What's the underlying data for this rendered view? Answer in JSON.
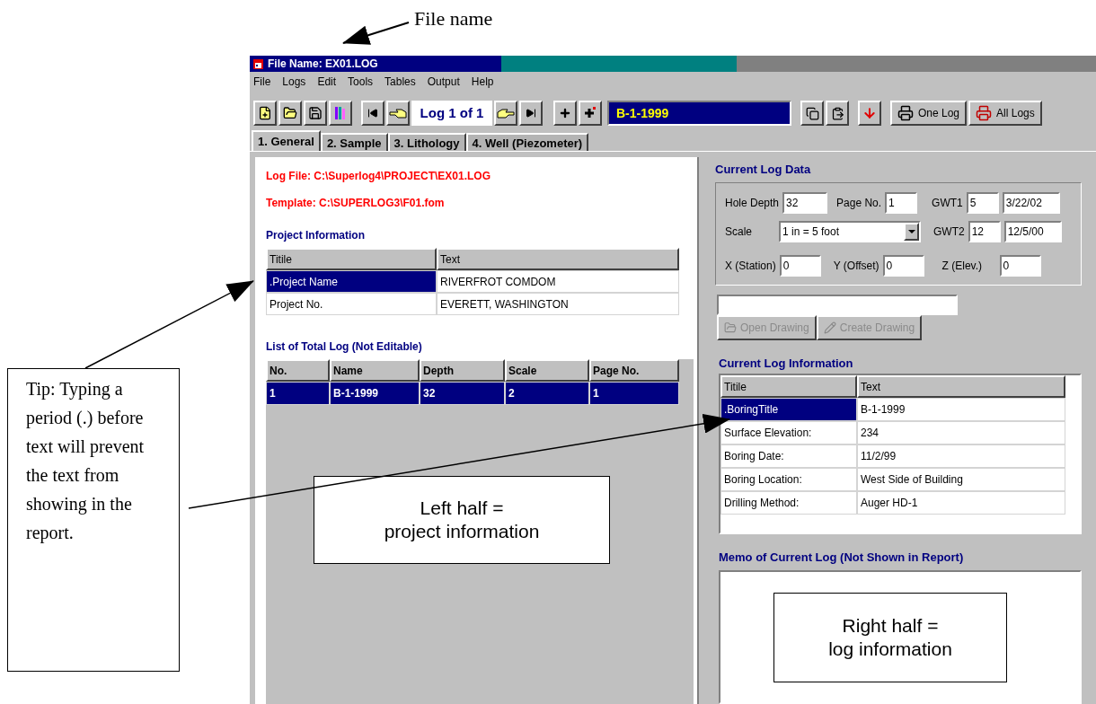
{
  "annotations": {
    "file_name_label": "File name",
    "tip": "Tip: Typing a period (.) before text will prevent the text from showing in the report.",
    "left_half": [
      "Left half =",
      "project information"
    ],
    "right_half": [
      "Right half =",
      "log information"
    ]
  },
  "window": {
    "title": "File Name: EX01.LOG"
  },
  "menu": [
    "File",
    "Logs",
    "Edit",
    "Tools",
    "Tables",
    "Output",
    "Help"
  ],
  "toolbar": {
    "log_counter": "Log 1 of 1",
    "log_name": "B-1-1999",
    "buttons": [
      {
        "kind": "print-one",
        "label": "One Log"
      },
      {
        "kind": "print-all",
        "label": "All Logs"
      }
    ]
  },
  "tabs": [
    {
      "label": "1. General",
      "selected": true
    },
    {
      "label": "2. Sample",
      "selected": false
    },
    {
      "label": "3. Lithology",
      "selected": false
    },
    {
      "label": "4. Well (Piezometer)",
      "selected": false
    }
  ],
  "general": {
    "log_file": "Log File: C:\\Superlog4\\PROJECT\\EX01.LOG",
    "template": "Template: C:\\SUPERLOG3\\F01.fom",
    "project_info": {
      "title": "Project Information",
      "columns": [
        "Titile",
        "Text"
      ],
      "rows": [
        {
          "cells": [
            ".Project Name",
            "RIVERFROT COMDOM"
          ],
          "selected": true
        },
        {
          "cells": [
            "Project No.",
            "EVERETT, WASHINGTON"
          ],
          "selected": false
        }
      ]
    },
    "total_log": {
      "title": "List of Total Log (Not Editable)",
      "columns": [
        "No.",
        "Name",
        "Depth",
        "Scale",
        "Page No."
      ],
      "rows": [
        {
          "cells": [
            "1",
            "B-1-1999",
            "32",
            "2",
            "1"
          ],
          "selected": true
        }
      ]
    }
  },
  "current_log_data": {
    "title": "Current Log Data",
    "hole_depth": {
      "label": "Hole Depth",
      "value": "32"
    },
    "page_no": {
      "label": "Page No.",
      "value": "1"
    },
    "gwt1": {
      "label": "GWT1",
      "value": "5",
      "date": "3/22/02"
    },
    "scale": {
      "label": "Scale",
      "value": "1 in = 5 foot"
    },
    "gwt2": {
      "label": "GWT2",
      "value": "12",
      "date": "12/5/00"
    },
    "x": {
      "label": "X (Station)",
      "value": "0"
    },
    "y": {
      "label": "Y (Offset)",
      "value": "0"
    },
    "z": {
      "label": "Z (Elev.)",
      "value": "0"
    }
  },
  "drawing_buttons": [
    {
      "kind": "open",
      "label": "Open Drawing",
      "disabled": true
    },
    {
      "kind": "create",
      "label": "Create Drawing",
      "disabled": true
    }
  ],
  "current_log_info": {
    "title": "Current Log Information",
    "columns": [
      "Titile",
      "Text"
    ],
    "rows": [
      {
        "cells": [
          ".BoringTitle",
          "B-1-1999"
        ],
        "selected": true
      },
      {
        "cells": [
          "Surface Elevation:",
          "234"
        ],
        "selected": false
      },
      {
        "cells": [
          "Boring Date:",
          "11/2/99"
        ],
        "selected": false
      },
      {
        "cells": [
          "Boring Location:",
          "West Side of Building"
        ],
        "selected": false
      },
      {
        "cells": [
          "Drilling Method:",
          "Auger HD-1"
        ],
        "selected": false
      }
    ]
  },
  "memo": {
    "title": "Memo of Current Log (Not Shown in Report)"
  }
}
